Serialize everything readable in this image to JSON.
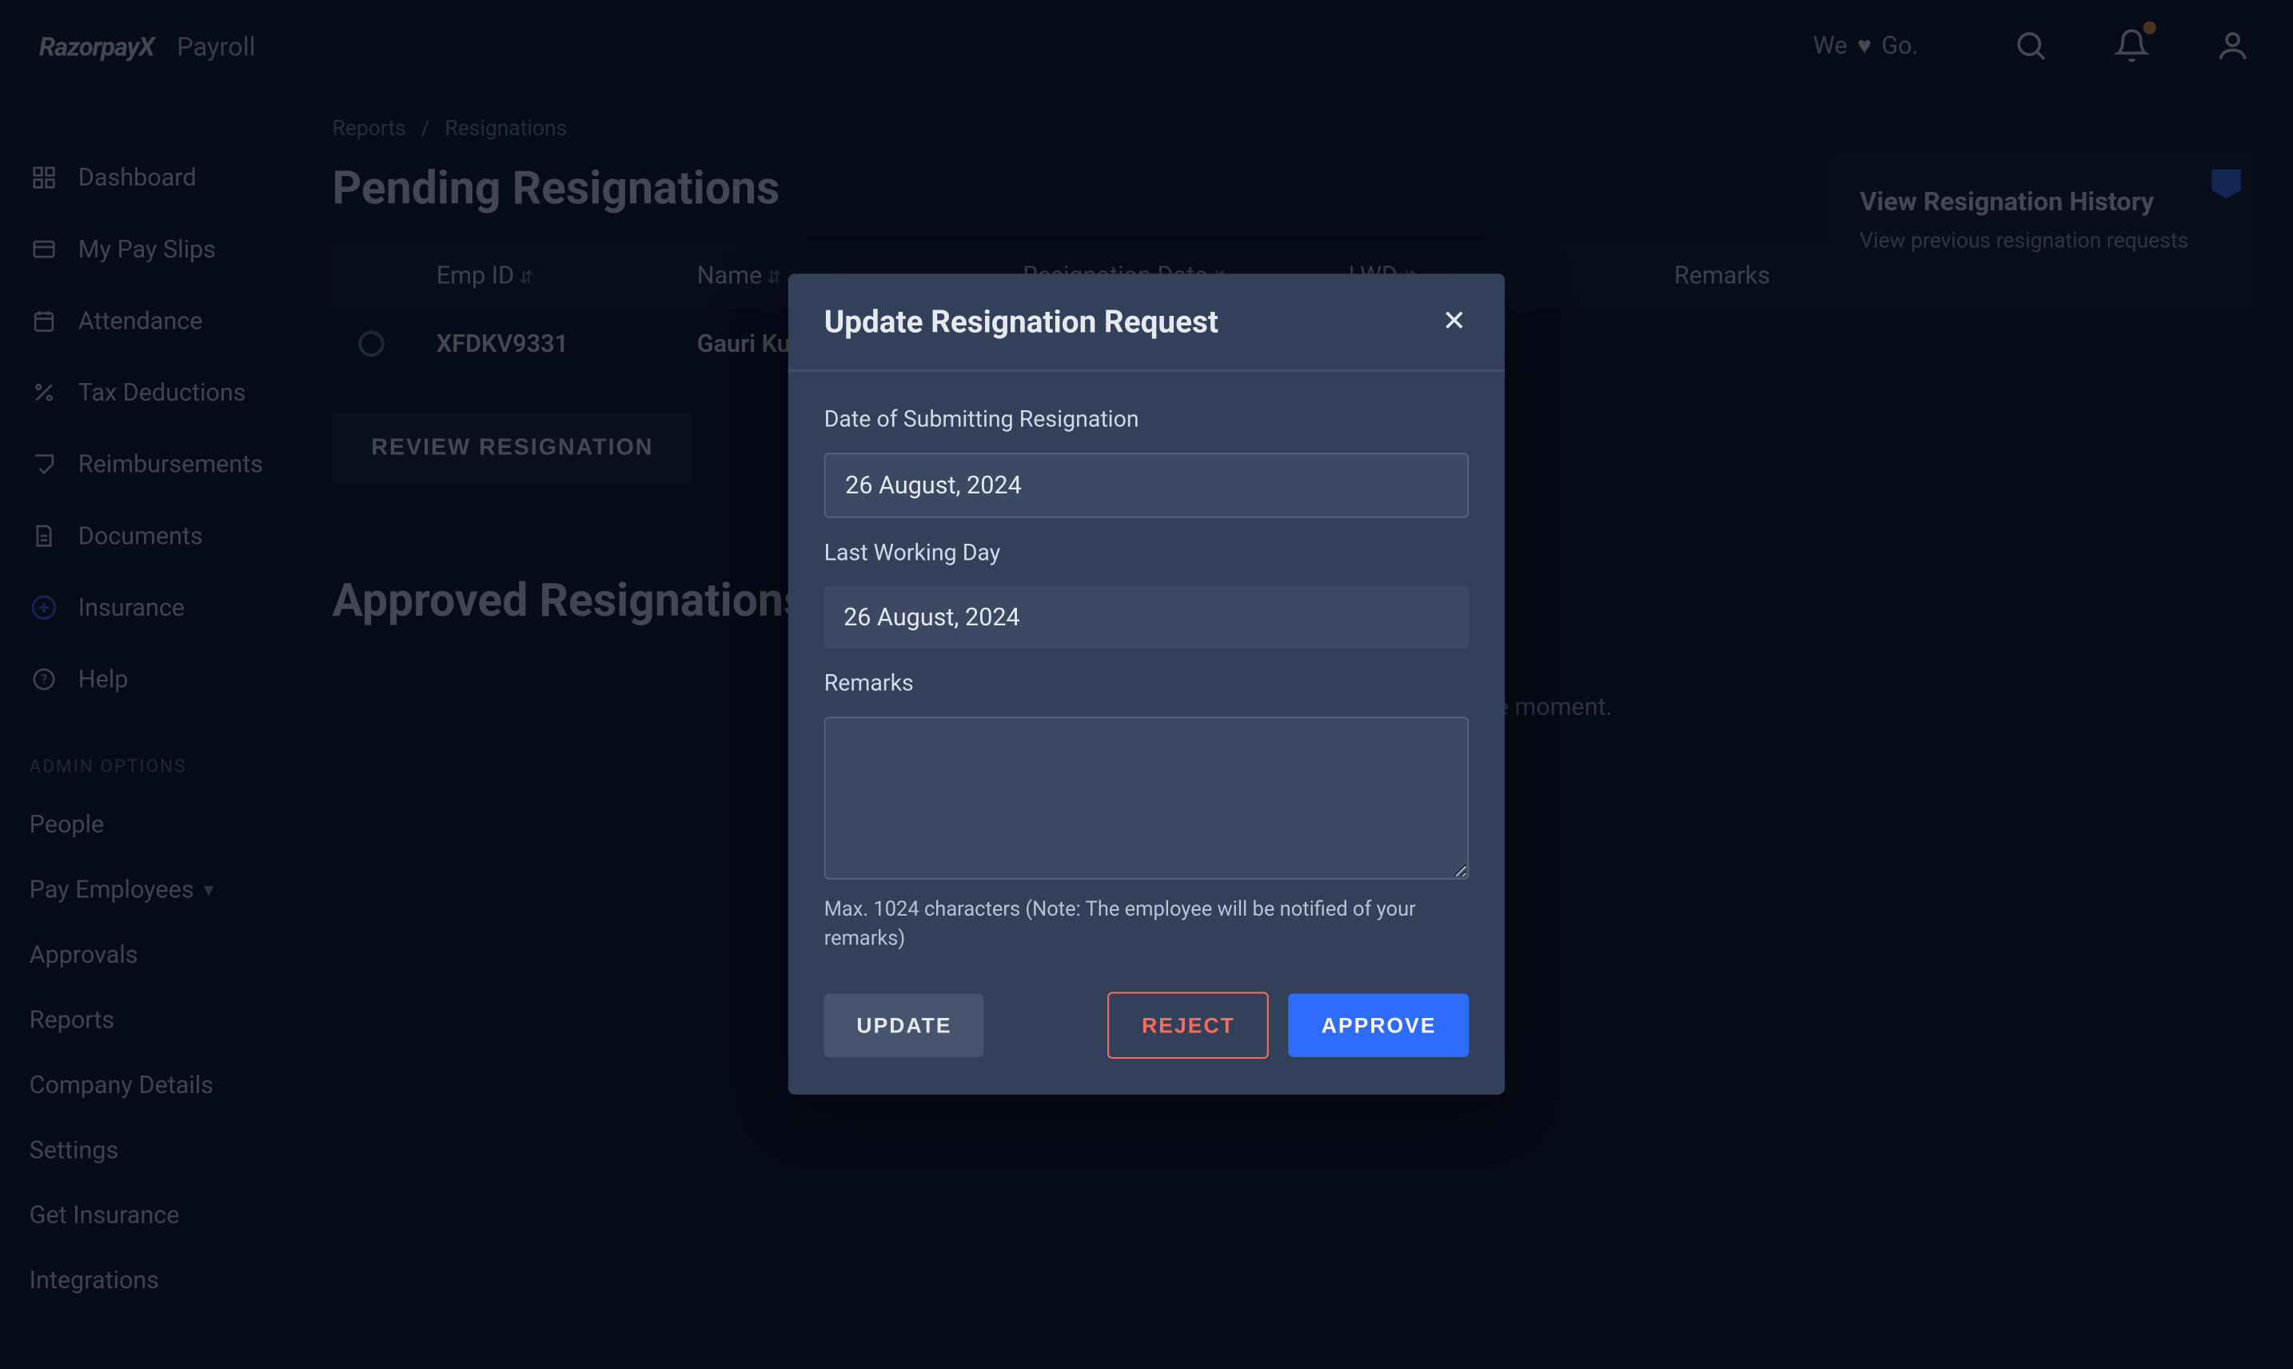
{
  "brand": {
    "name": "RazorpayX",
    "product": "Payroll"
  },
  "topbar": {
    "heart_prefix": "We",
    "heart_suffix": "Go.",
    "icons": {
      "search": "search-icon",
      "bell": "bell-icon",
      "user": "user-icon"
    }
  },
  "sidebar": {
    "items": [
      {
        "label": "Dashboard"
      },
      {
        "label": "My Pay Slips"
      },
      {
        "label": "Attendance"
      },
      {
        "label": "Tax Deductions"
      },
      {
        "label": "Reimbursements"
      },
      {
        "label": "Documents"
      },
      {
        "label": "Insurance"
      },
      {
        "label": "Help"
      }
    ],
    "admin_label": "ADMIN OPTIONS",
    "admin": [
      {
        "label": "People"
      },
      {
        "label": "Pay Employees",
        "has_submenu": true
      },
      {
        "label": "Approvals"
      },
      {
        "label": "Reports"
      },
      {
        "label": "Company Details"
      },
      {
        "label": "Settings"
      },
      {
        "label": "Get Insurance"
      },
      {
        "label": "Integrations"
      }
    ]
  },
  "breadcrumbs": {
    "root": "Reports",
    "leaf": "Resignations"
  },
  "pending": {
    "heading": "Pending Resignations",
    "columns": [
      "Emp ID",
      "Name",
      "Resignation Date",
      "LWD",
      "Remarks"
    ],
    "rows": [
      {
        "emp_id": "XFDKV9331",
        "name": "Gauri Kumari",
        "date": "",
        "lwd": "",
        "remarks": ""
      }
    ],
    "review_button": "REVIEW RESIGNATION"
  },
  "approved": {
    "heading": "Approved Resignations",
    "empty": "You have no approved resignation requests at the moment."
  },
  "history": {
    "title": "View Resignation History",
    "subtitle": "View previous resignation requests"
  },
  "modal": {
    "title": "Update Resignation Request",
    "date_label": "Date of Submitting Resignation",
    "date_value": "26 August, 2024",
    "lwd_label": "Last Working Day",
    "lwd_value": "26 August, 2024",
    "remarks_label": "Remarks",
    "remarks_value": "",
    "hint": "Max. 1024 characters (Note: The employee will be notified of your remarks)",
    "update": "UPDATE",
    "reject": "REJECT",
    "approve": "APPROVE"
  }
}
